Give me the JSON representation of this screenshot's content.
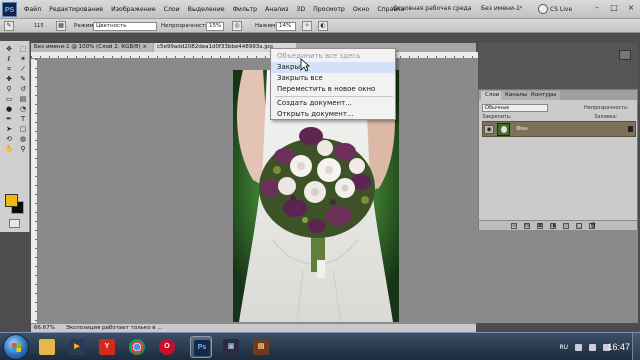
{
  "app": {
    "logo": "PS",
    "menu": [
      "Файл",
      "Редактирование",
      "Изображение",
      "Слои",
      "Выделение",
      "Фильтр",
      "Анализ",
      "3D",
      "Просмотр",
      "Окно",
      "Справка"
    ],
    "zoom": "66.7",
    "workspace_label": "Основная рабочая среда",
    "workspace_doc": "Без имени-1",
    "workspace_arrow": "»",
    "cslive": "CS Live",
    "window_buttons": [
      "–",
      "□",
      "×"
    ]
  },
  "options_bar": {
    "mode_label": "Режим:",
    "mode_value": "Цветность",
    "opacity_label": "Непрозрачность:",
    "opacity_value": "15%",
    "pressure_label": "Нажим:",
    "pressure_value": "14%",
    "brush_size": "115"
  },
  "documents": {
    "tab1": "Без имени-1 @ 100% (Слой 2, RGB/8) ×",
    "tab2": "c5e99add2082dea1d0f33bbe448993a.jpg"
  },
  "context_menu": {
    "items": [
      {
        "label": "Объединить все здесь",
        "disabled": true
      },
      {
        "label": "Закрыть",
        "hover": true
      },
      {
        "label": "Закрыть все"
      },
      {
        "label": "Переместить в новое окно"
      },
      {
        "label": "Создать документ..."
      },
      {
        "label": "Открыть документ..."
      }
    ]
  },
  "layers_panel": {
    "tabs": [
      "Слои",
      "Каналы",
      "Контуры"
    ],
    "blend_mode": "Обычные",
    "opacity_label": "Непрозрачность:",
    "lock_label": "Закрепить:",
    "fill_label": "Заливка:",
    "layer_name": "Фон"
  },
  "status_bar": {
    "zoom": "66.67%",
    "info": "Экспозиция работает только в ..."
  },
  "taskbar": {
    "lang": "RU",
    "time": "16:47"
  },
  "colors": {
    "foreground": "#f0b80e",
    "background": "#0a0a0a",
    "layer_selected": "#7f7158"
  }
}
